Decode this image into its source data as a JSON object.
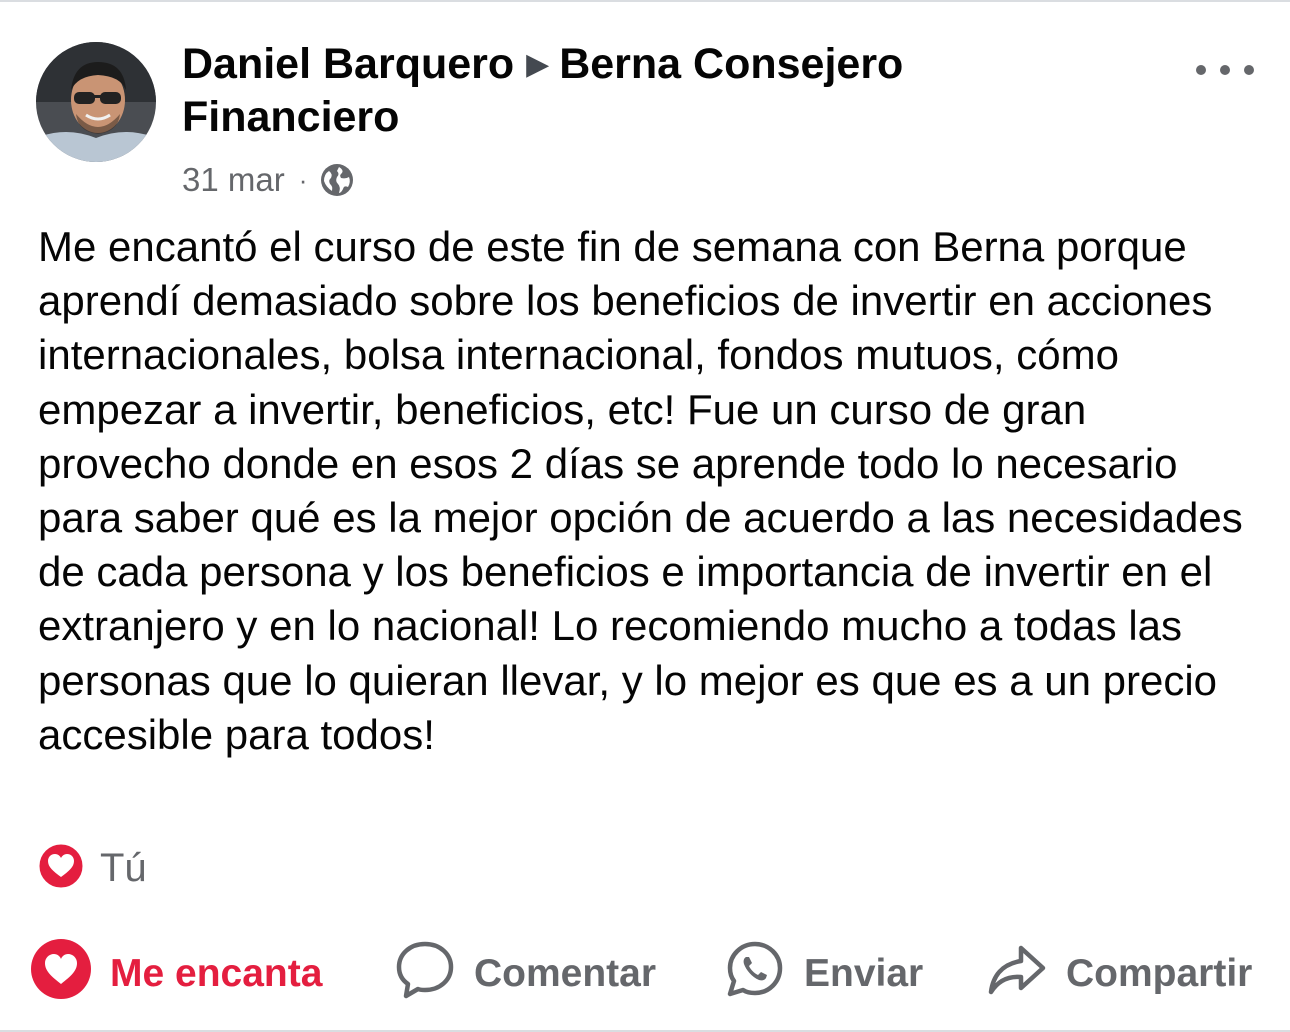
{
  "post": {
    "author": "Daniel Barquero",
    "arrow": "▶",
    "target_line1": "Berna Consejero",
    "target_line2": "Financiero",
    "date": "31 mar",
    "separator": "·",
    "audience_icon": "globe-icon",
    "more_icon": "more-options-icon",
    "text": "Me encantó el curso de este fin de semana con Berna porque aprendí demasiado sobre los beneficios de invertir en acciones internacionales, bolsa internacional, fondos mutuos, cómo empezar a invertir, beneficios, etc! Fue un curso de gran provecho donde en esos 2 días se aprende todo lo necesario para saber qué es la mejor opción de acuerdo a las necesidades de cada persona y los beneficios e importancia de invertir en el extranjero y en lo nacional! Lo recomiendo mucho a todas las personas que lo quieran llevar, y lo mejor es que es a un precio accesible para todos!"
  },
  "reactions": {
    "icon": "love-reaction-icon",
    "label": "Tú"
  },
  "actions": {
    "love_label": "Me encanta",
    "comment_label": "Comentar",
    "send_label": "Enviar",
    "share_label": "Compartir"
  },
  "colors": {
    "love_red": "#e41e3f",
    "secondary_text": "#65676b",
    "primary_text": "#050505"
  }
}
